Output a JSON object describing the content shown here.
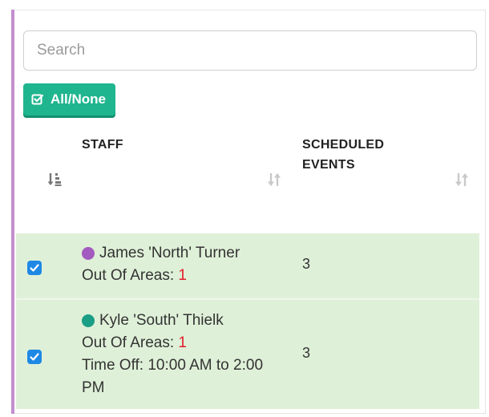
{
  "search": {
    "placeholder": "Search",
    "value": ""
  },
  "toolbar": {
    "all_none_label": "All/None",
    "all_none_icon": "checkbox-icon"
  },
  "table": {
    "columns": [
      {
        "label": "",
        "sort_icon": "sort-numeric-asc-icon"
      },
      {
        "label": "STAFF",
        "sort_icon": "sort-icon"
      },
      {
        "label_line1": "SCHEDULED",
        "label_line2": "EVENTS",
        "sort_icon": "sort-icon"
      }
    ],
    "rows": [
      {
        "checked": true,
        "name": "James 'North' Turner",
        "dot_color": "#a35bbf",
        "out_of_areas_label": "Out Of Areas:",
        "out_of_areas_value": "1",
        "scheduled_events": "3"
      },
      {
        "checked": true,
        "name": "Kyle 'South' Thielk",
        "dot_color": "#1a9e86",
        "out_of_areas_label": "Out Of Areas:",
        "out_of_areas_value": "1",
        "time_off_line1": "Time Off: 10:00 AM to 2:00",
        "time_off_line2": "PM",
        "scheduled_events": "3"
      }
    ]
  },
  "colors": {
    "accent_bar": "#c38fcd",
    "button_green": "#1fb58f",
    "row_bg": "#dff0d8",
    "checkbox_blue": "#1e88e5",
    "out_of_areas_value": "#e0202c"
  }
}
